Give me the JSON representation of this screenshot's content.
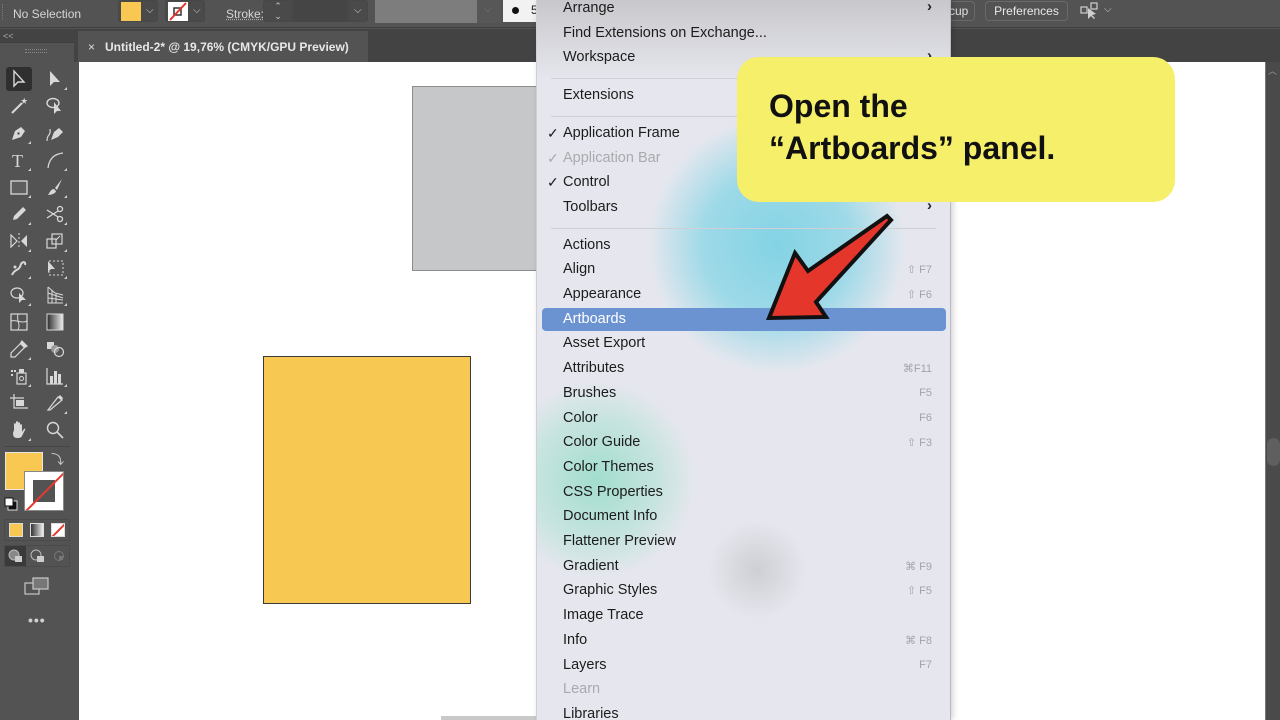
{
  "control_bar": {
    "selection_status": "No Selection",
    "fill_color": "#f8c853",
    "stroke_label": "Stroke:",
    "stroke_value": "",
    "brush_size_partial": "5",
    "setup_button_partial": "cup",
    "preferences_button": "Preferences"
  },
  "document_tab": {
    "close_glyph": "×",
    "title": "Untitled-2* @ 19,76% (CMYK/GPU Preview)"
  },
  "toolbar": {
    "collapse_glyph": "<<",
    "tools": [
      {
        "name": "selection-tool",
        "active": true
      },
      {
        "name": "direct-selection-tool"
      },
      {
        "name": "magic-wand-tool"
      },
      {
        "name": "lasso-selection-tool"
      },
      {
        "name": "pen-tool"
      },
      {
        "name": "curvature-tool"
      },
      {
        "name": "type-tool",
        "glyph": "T"
      },
      {
        "name": "arc-tool"
      },
      {
        "name": "rectangle-tool"
      },
      {
        "name": "paintbrush-tool"
      },
      {
        "name": "pencil-tool"
      },
      {
        "name": "scissors-tool"
      },
      {
        "name": "reflect-tool"
      },
      {
        "name": "scale-tool"
      },
      {
        "name": "puppet-warp-tool"
      },
      {
        "name": "free-transform-tool"
      },
      {
        "name": "shape-builder-tool"
      },
      {
        "name": "perspective-grid-tool"
      },
      {
        "name": "mesh-tool"
      },
      {
        "name": "gradient-tool"
      },
      {
        "name": "eyedropper-tool"
      },
      {
        "name": "blend-tool"
      },
      {
        "name": "symbol-sprayer-tool"
      },
      {
        "name": "column-graph-tool"
      },
      {
        "name": "artboard-tool"
      },
      {
        "name": "slice-tool"
      },
      {
        "name": "hand-tool"
      },
      {
        "name": "zoom-tool"
      }
    ],
    "fill_color": "#f8c853",
    "stroke_color": "none",
    "more_glyph": "•••"
  },
  "canvas": {
    "objects": [
      {
        "name": "gray-rectangle",
        "color": "#c6c7c9"
      },
      {
        "name": "yellow-rectangle",
        "color": "#f7c852"
      }
    ]
  },
  "menu": {
    "items": [
      {
        "label": "Arrange",
        "submenu": true
      },
      {
        "label": "Find Extensions on Exchange..."
      },
      {
        "label": "Workspace",
        "submenu": true
      },
      {
        "separator": true
      },
      {
        "label": "Extensions",
        "submenu": true
      },
      {
        "separator": true
      },
      {
        "label": "Application Frame",
        "checked": true
      },
      {
        "label": "Application Bar",
        "checked": true,
        "disabled": true
      },
      {
        "label": "Control",
        "checked": true
      },
      {
        "label": "Toolbars",
        "submenu": true
      },
      {
        "separator": true
      },
      {
        "label": "Actions"
      },
      {
        "label": "Align",
        "shortcut": "⇧ F7"
      },
      {
        "label": "Appearance",
        "shortcut": "⇧ F6"
      },
      {
        "label": "Artboards",
        "highlighted": true
      },
      {
        "label": "Asset Export"
      },
      {
        "label": "Attributes",
        "shortcut": "⌘F11"
      },
      {
        "label": "Brushes",
        "shortcut": "F5"
      },
      {
        "label": "Color",
        "shortcut": "F6"
      },
      {
        "label": "Color Guide",
        "shortcut": "⇧ F3"
      },
      {
        "label": "Color Themes"
      },
      {
        "label": "CSS Properties"
      },
      {
        "label": "Document Info"
      },
      {
        "label": "Flattener Preview"
      },
      {
        "label": "Gradient",
        "shortcut": "⌘ F9"
      },
      {
        "label": "Graphic Styles",
        "shortcut": "⇧ F5"
      },
      {
        "label": "Image Trace"
      },
      {
        "label": "Info",
        "shortcut": "⌘ F8"
      },
      {
        "label": "Layers",
        "shortcut": "F7"
      },
      {
        "label": "Learn",
        "disabled": true
      },
      {
        "label": "Libraries"
      }
    ],
    "check_glyph": "✓",
    "submenu_glyph": "›"
  },
  "callout": {
    "line1": "Open the",
    "line2": "“Artboards” panel.",
    "background": "#f5ef6a",
    "arrow_color": "#e5362b"
  }
}
